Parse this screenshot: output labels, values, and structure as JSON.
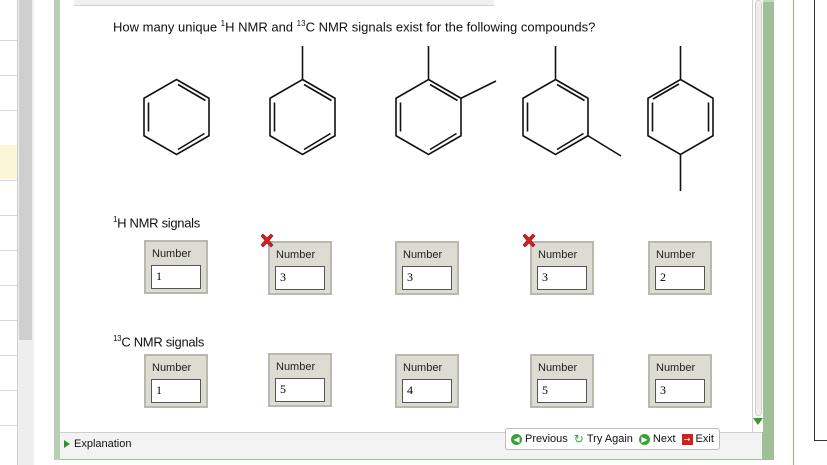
{
  "question": {
    "prefix": "How many unique ",
    "sup_h": "1",
    "mid1": "H NMR and ",
    "sup_c": "13",
    "mid2": "C NMR signals exist for the following compounds?"
  },
  "h_section": {
    "sup": "1",
    "label": "H NMR signals"
  },
  "c_section": {
    "sup": "13",
    "label": "C NMR signals"
  },
  "field_label": "Number",
  "h_answers": [
    {
      "value": "1",
      "marked_wrong": false
    },
    {
      "value": "3",
      "marked_wrong": true
    },
    {
      "value": "3",
      "marked_wrong": false
    },
    {
      "value": "3",
      "marked_wrong": true
    },
    {
      "value": "2",
      "marked_wrong": false
    }
  ],
  "c_answers": [
    {
      "value": "1"
    },
    {
      "value": "5"
    },
    {
      "value": "4"
    },
    {
      "value": "5"
    },
    {
      "value": "3"
    }
  ],
  "compounds": [
    "benzene",
    "toluene",
    "ortho-xylene",
    "meta-xylene",
    "para-xylene"
  ],
  "bottom": {
    "explanation": "Explanation",
    "previous": "Previous",
    "try_again": "Try Again",
    "next": "Next",
    "exit": "Exit"
  },
  "colors": {
    "wrong_mark": "#d42020",
    "accent_green": "#3aa13a"
  }
}
